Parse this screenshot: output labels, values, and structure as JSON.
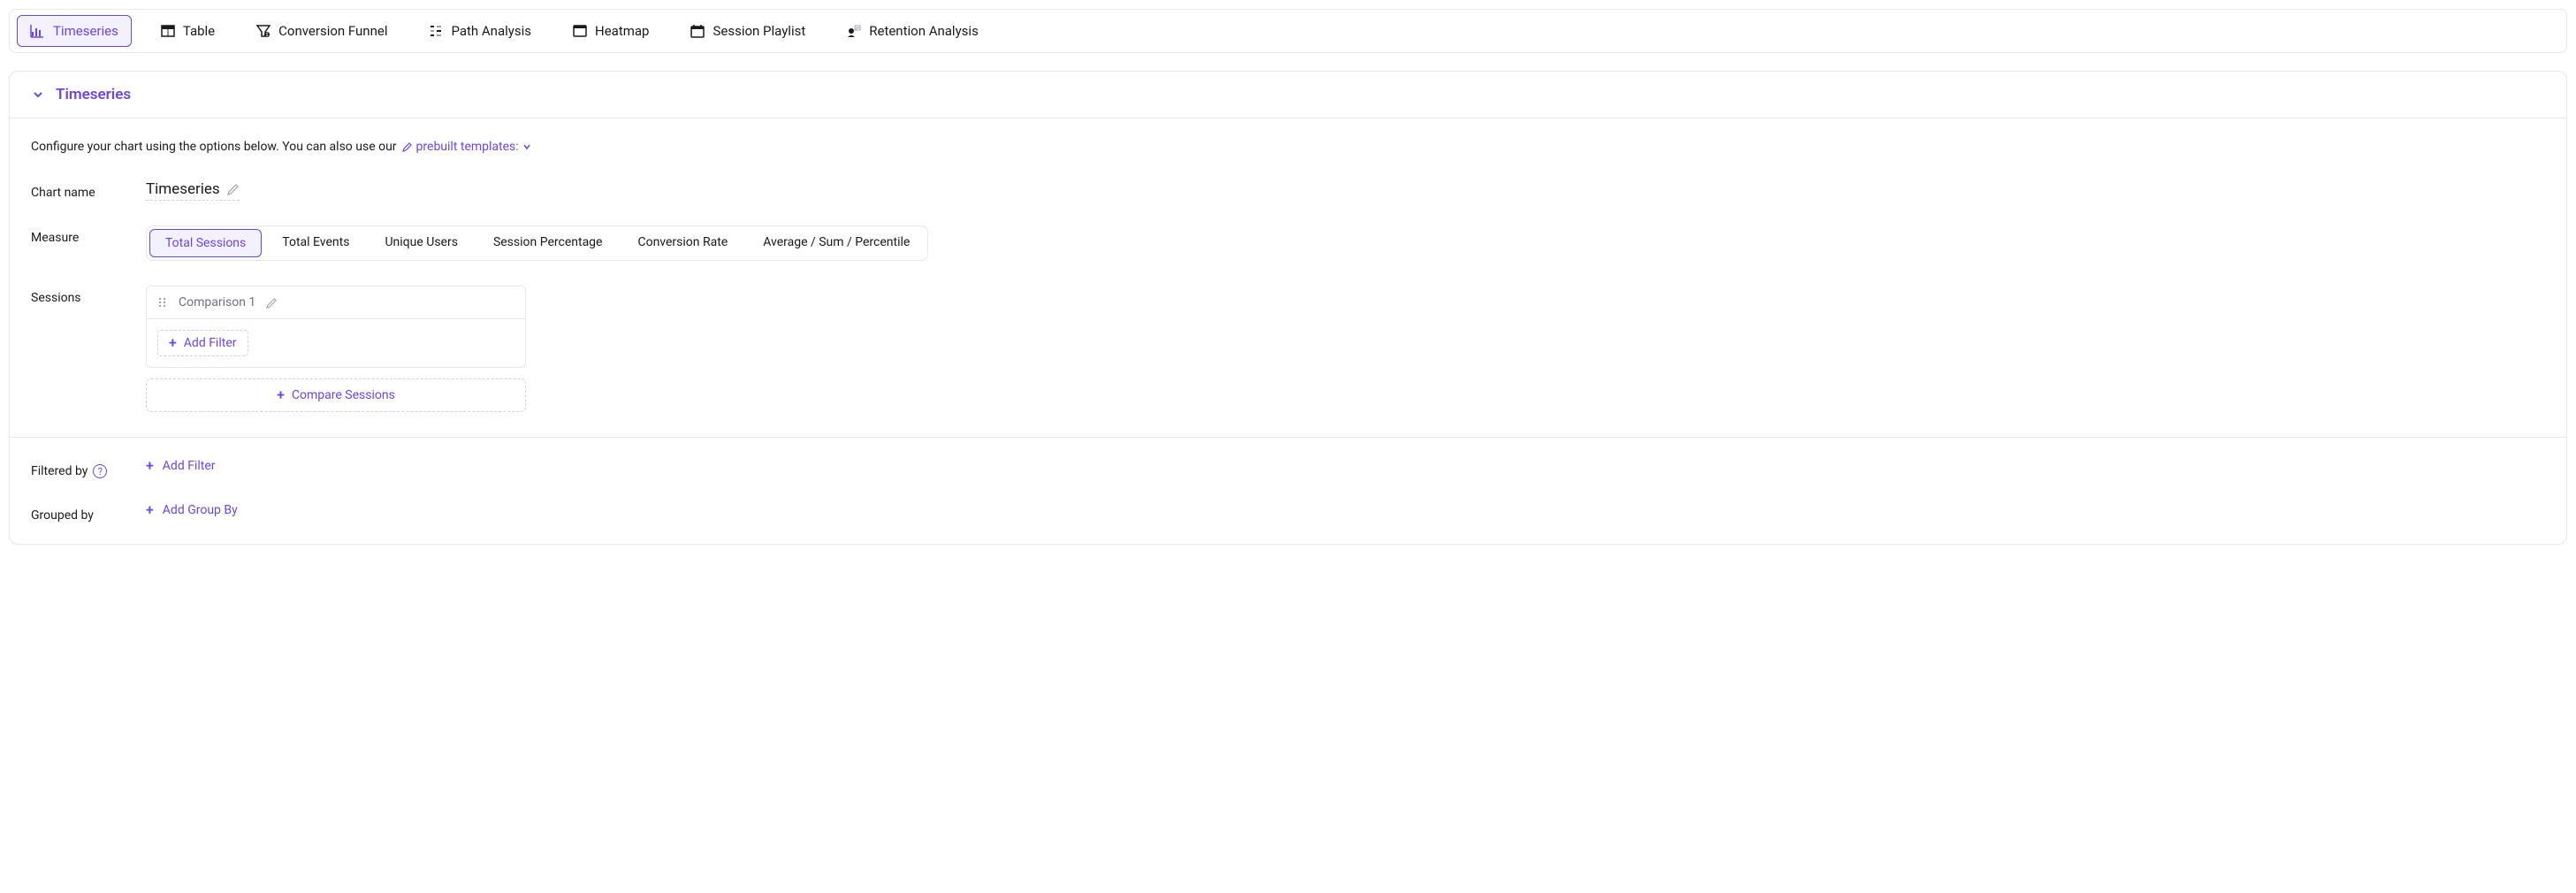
{
  "tabs": [
    {
      "id": "timeseries",
      "label": "Timeseries",
      "active": true
    },
    {
      "id": "table",
      "label": "Table",
      "active": false
    },
    {
      "id": "conversion-funnel",
      "label": "Conversion Funnel",
      "active": false
    },
    {
      "id": "path-analysis",
      "label": "Path Analysis",
      "active": false
    },
    {
      "id": "heatmap",
      "label": "Heatmap",
      "active": false
    },
    {
      "id": "session-playlist",
      "label": "Session Playlist",
      "active": false
    },
    {
      "id": "retention-analysis",
      "label": "Retention Analysis",
      "active": false
    }
  ],
  "panel": {
    "title": "Timeseries",
    "config_text": "Configure your chart using the options below. You can also use our",
    "template_link": "prebuilt templates:"
  },
  "chart_name": {
    "label": "Chart name",
    "value": "Timeseries"
  },
  "measure": {
    "label": "Measure",
    "options": [
      {
        "label": "Total Sessions",
        "active": true
      },
      {
        "label": "Total Events",
        "active": false
      },
      {
        "label": "Unique Users",
        "active": false
      },
      {
        "label": "Session Percentage",
        "active": false
      },
      {
        "label": "Conversion Rate",
        "active": false
      },
      {
        "label": "Average / Sum / Percentile",
        "active": false
      }
    ]
  },
  "sessions": {
    "label": "Sessions",
    "comparison_label": "Comparison 1",
    "add_filter": "Add Filter",
    "compare_sessions": "Compare Sessions"
  },
  "filtered_by": {
    "label": "Filtered by",
    "add_filter": "Add Filter"
  },
  "grouped_by": {
    "label": "Grouped by",
    "add_group_by": "Add Group By"
  }
}
